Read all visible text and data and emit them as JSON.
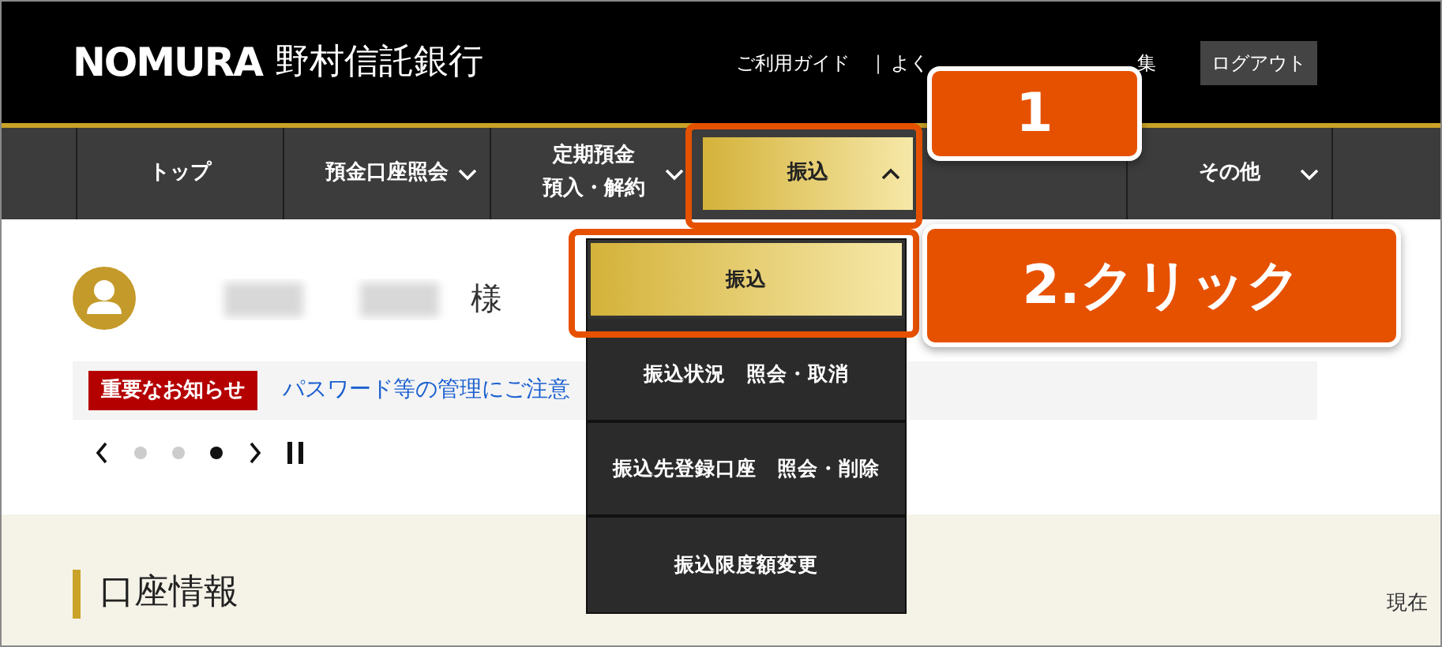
{
  "header": {
    "logo": "NOMURA",
    "bank_name": "野村信託銀行",
    "links": [
      {
        "label": "ご利用ガイド"
      },
      {
        "label": "よく"
      },
      {
        "label": "集"
      }
    ],
    "separator": "|",
    "logout": "ログアウト"
  },
  "nav": [
    {
      "kind": "link",
      "lines": [
        "トップ"
      ],
      "selected": false
    },
    {
      "kind": "menu",
      "lines": [
        "預金口座照会"
      ],
      "selected": false,
      "expanded": false
    },
    {
      "kind": "menu",
      "lines": [
        "定期預金",
        "預入・解約"
      ],
      "selected": false,
      "expanded": false
    },
    {
      "kind": "menu",
      "lines": [
        "振込"
      ],
      "selected": true,
      "expanded": true
    },
    {
      "kind": "blank"
    },
    {
      "kind": "menu",
      "lines": [
        "その他"
      ],
      "selected": false,
      "expanded": false
    }
  ],
  "dropdown": [
    {
      "label": "振込",
      "selected": true
    },
    {
      "label": "振込状況　照会・取消",
      "selected": false
    },
    {
      "label": "振込先登録口座　照会・削除",
      "selected": false
    },
    {
      "label": "振込限度額変更",
      "selected": false
    }
  ],
  "callouts": [
    {
      "text": "1"
    },
    {
      "text": "2.クリック"
    }
  ],
  "greeting": {
    "honorific": "様"
  },
  "notice": {
    "badge": "重要なお知らせ",
    "text": "パスワード等の管理にご注意"
  },
  "carousel": {
    "dots": [
      {
        "selected": false
      },
      {
        "selected": false
      },
      {
        "selected": true
      }
    ]
  },
  "account": {
    "title": "口座情報",
    "as_of": "現在"
  }
}
